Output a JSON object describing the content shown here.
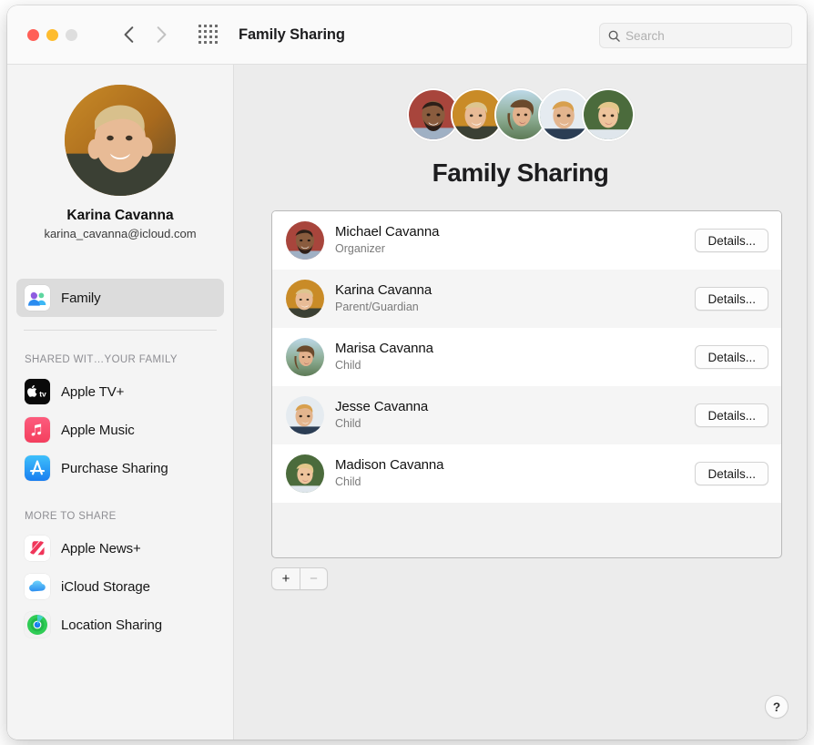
{
  "window": {
    "title": "Family Sharing",
    "traffic_lights": [
      "close",
      "minimize",
      "zoom"
    ],
    "back_label": "Back",
    "forward_label": "Forward",
    "grid_label": "Show All Preferences"
  },
  "search": {
    "placeholder": "Search",
    "value": "",
    "icon": "search-icon"
  },
  "sidebar": {
    "profile": {
      "name": "Karina Cavanna",
      "email": "karina_cavanna@icloud.com",
      "avatar": "karina-avatar"
    },
    "selected_item": {
      "label": "Family",
      "icon": "family-people-icon"
    },
    "sections": [
      {
        "header": "SHARED WIT…YOUR FAMILY",
        "items": [
          {
            "label": "Apple TV+",
            "icon": "apple-tv-icon"
          },
          {
            "label": "Apple Music",
            "icon": "apple-music-icon"
          },
          {
            "label": "Purchase Sharing",
            "icon": "app-store-icon"
          }
        ]
      },
      {
        "header": "MORE TO SHARE",
        "items": [
          {
            "label": "Apple News+",
            "icon": "apple-news-icon"
          },
          {
            "label": "iCloud Storage",
            "icon": "icloud-icon"
          },
          {
            "label": "Location Sharing",
            "icon": "find-my-icon"
          }
        ]
      }
    ]
  },
  "main": {
    "title": "Family Sharing",
    "avatar_cluster": [
      "michael-avatar",
      "karina-avatar",
      "marisa-avatar",
      "jesse-avatar",
      "madison-avatar"
    ],
    "members": [
      {
        "name": "Michael Cavanna",
        "role": "Organizer",
        "button": "Details...",
        "avatar": "michael-avatar"
      },
      {
        "name": "Karina Cavanna",
        "role": "Parent/Guardian",
        "button": "Details...",
        "avatar": "karina-avatar"
      },
      {
        "name": "Marisa Cavanna",
        "role": "Child",
        "button": "Details...",
        "avatar": "marisa-avatar"
      },
      {
        "name": "Jesse Cavanna",
        "role": "Child",
        "button": "Details...",
        "avatar": "jesse-avatar"
      },
      {
        "name": "Madison Cavanna",
        "role": "Child",
        "button": "Details...",
        "avatar": "madison-avatar"
      }
    ],
    "add_button": "+",
    "remove_button": "−",
    "help_button": "?"
  },
  "colors": {
    "window_bg": "#ececec",
    "sidebar_bg": "#f4f4f4",
    "titlebar_bg": "#fafafa",
    "selected_row": "#dcdcdc",
    "row_alt": "#f5f5f5",
    "row_white": "#ffffff",
    "traffic_red": "#ff5f57",
    "traffic_yellow": "#febc2e",
    "traffic_gray": "#dedede",
    "muted_text": "#8e8e93"
  }
}
